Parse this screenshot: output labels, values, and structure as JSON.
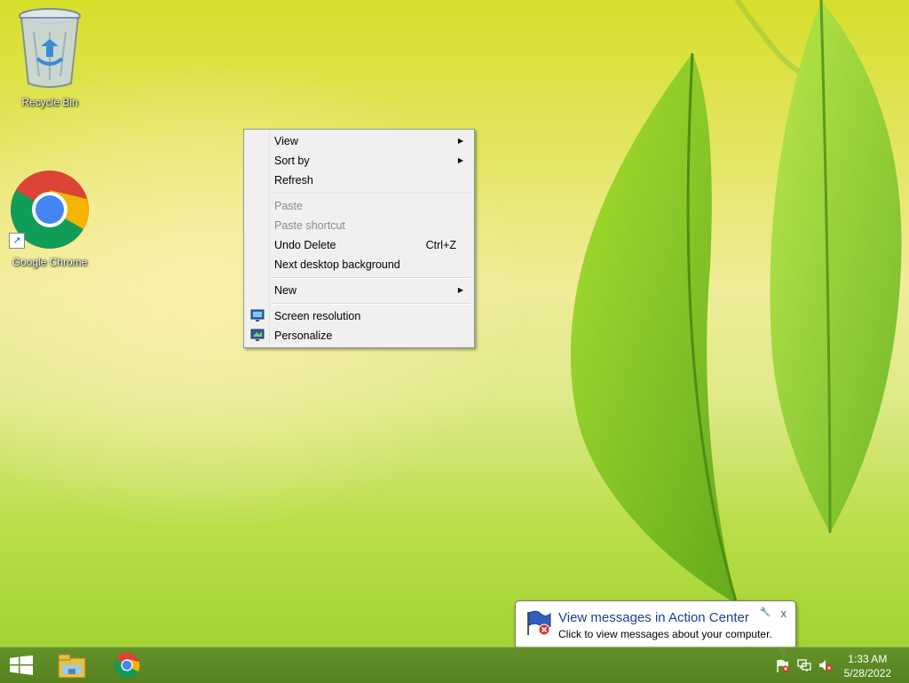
{
  "desktop": {
    "icons": [
      {
        "label": "Recycle Bin",
        "icon": "recycle-bin-icon"
      },
      {
        "label": "Google Chrome",
        "icon": "chrome-icon"
      }
    ]
  },
  "context_menu": {
    "items": [
      {
        "label": "View",
        "has_submenu": true
      },
      {
        "label": "Sort by",
        "has_submenu": true
      },
      {
        "label": "Refresh"
      },
      {
        "label": "Paste",
        "disabled": true
      },
      {
        "label": "Paste shortcut",
        "disabled": true
      },
      {
        "label": "Undo Delete",
        "shortcut": "Ctrl+Z"
      },
      {
        "label": "Next desktop background"
      },
      {
        "label": "New",
        "has_submenu": true
      },
      {
        "label": "Screen resolution",
        "icon": "screen-resolution-icon"
      },
      {
        "label": "Personalize",
        "icon": "personalize-icon"
      }
    ]
  },
  "taskbar": {
    "start_icon": "windows-logo-icon",
    "pinned": [
      "file-explorer-icon",
      "chrome-icon"
    ],
    "tray": [
      "action-center-flag-icon",
      "network-icon",
      "volume-muted-icon"
    ],
    "clock": {
      "time": "1:33 AM",
      "date": "5/28/2022"
    }
  },
  "notification": {
    "title": "View messages in Action Center",
    "body": "Click to view messages about your computer.",
    "close": "x"
  },
  "colors": {
    "menu_bg": "#f0f0f0",
    "taskbar": "#5f8c28",
    "balloon_title": "#1e3f8f"
  }
}
